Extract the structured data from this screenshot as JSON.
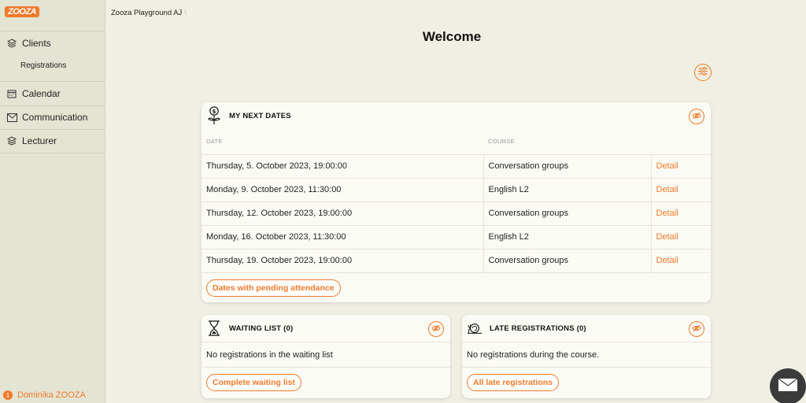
{
  "brand": {
    "logo_text": "ZOOZA",
    "accent": "#f07a2b"
  },
  "breadcrumb": {
    "org": "Zooza Playground AJ",
    "separator": "\\"
  },
  "page": {
    "title": "Welcome"
  },
  "sidebar": {
    "items": [
      {
        "label": "Clients",
        "icon": "clients-icon"
      },
      {
        "label": "Registrations",
        "icon": ""
      },
      {
        "label": "Calendar",
        "icon": "calendar-icon"
      },
      {
        "label": "Communication",
        "icon": "envelope-icon"
      },
      {
        "label": "Lecturer",
        "icon": "layers-icon"
      }
    ],
    "user": {
      "badge": "1",
      "name": "Dominika ZOOZA"
    }
  },
  "next_dates": {
    "title": "MY NEXT DATES",
    "columns": [
      "DATE",
      "COURSE",
      ""
    ],
    "rows": [
      {
        "date": "Thursday, 5. October 2023, 19:00:00",
        "course": "Conversation groups",
        "action": "Detail"
      },
      {
        "date": "Monday, 9. October 2023, 11:30:00",
        "course": "English L2",
        "action": "Detail"
      },
      {
        "date": "Thursday, 12. October 2023, 19:00:00",
        "course": "Conversation groups",
        "action": "Detail"
      },
      {
        "date": "Monday, 16. October 2023, 11:30:00",
        "course": "English L2",
        "action": "Detail"
      },
      {
        "date": "Thursday, 19. October 2023, 19:00:00",
        "course": "Conversation groups",
        "action": "Detail"
      }
    ],
    "button": "Dates with pending attendance"
  },
  "waiting_list": {
    "title": "WAITING LIST (0)",
    "empty": "No registrations in the waiting list",
    "button": "Complete waiting list"
  },
  "late_registrations": {
    "title": "LATE REGISTRATIONS (0)",
    "empty": "No registrations during the course.",
    "button": "All late registrations"
  }
}
